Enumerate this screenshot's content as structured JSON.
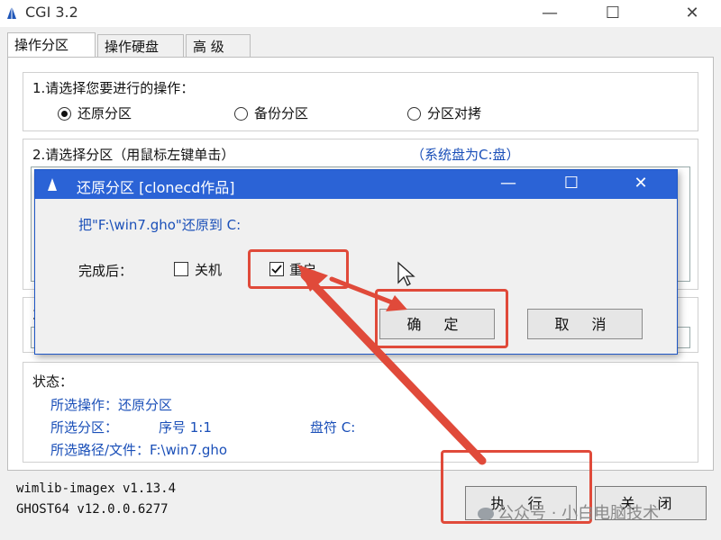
{
  "window": {
    "title": "CGI 3.2",
    "minimize": "—",
    "maximize": "☐",
    "close": "✕"
  },
  "tabs": [
    {
      "label": "操作分区"
    },
    {
      "label": "操作硬盘"
    },
    {
      "label": "高 级"
    }
  ],
  "step1": {
    "label": "1.请选择您要进行的操作：",
    "options": [
      {
        "label": "还原分区",
        "selected": true
      },
      {
        "label": "备份分区",
        "selected": false
      },
      {
        "label": "分区对拷",
        "selected": false
      }
    ]
  },
  "step2": {
    "label": "2.请选择分区（用鼠标左键单击）",
    "note": "（系统盘为C:盘）"
  },
  "step3": {
    "label": "3"
  },
  "dialog": {
    "title": "还原分区  [clonecd作品]",
    "message": "把\"F:\\win7.gho\"还原到 C:",
    "after_label": "完成后：",
    "shutdown_label": "关机",
    "shutdown_checked": false,
    "restart_label": "重启",
    "restart_checked": true,
    "ok": "确 定",
    "cancel": "取 消",
    "minimize": "—",
    "maximize": "☐",
    "close": "✕"
  },
  "status": {
    "heading": "状态：",
    "operation": "所选操作：还原分区",
    "partition_label": "所选分区：",
    "partition_number": "序号 1:1",
    "drive_letter": "盘符 C:",
    "path": "所选路径/文件：F:\\win7.gho"
  },
  "footer": {
    "wimlib": "wimlib-imagex v1.13.4",
    "ghost": "GHOST64 v12.0.0.6277",
    "execute": "执 行",
    "close": "关 闭"
  },
  "watermark": "公众号 · 小白电脑技术",
  "colors": {
    "highlight": "#e04a3a",
    "dialog_title": "#2b63d6",
    "status_text": "#1a4fb8"
  }
}
